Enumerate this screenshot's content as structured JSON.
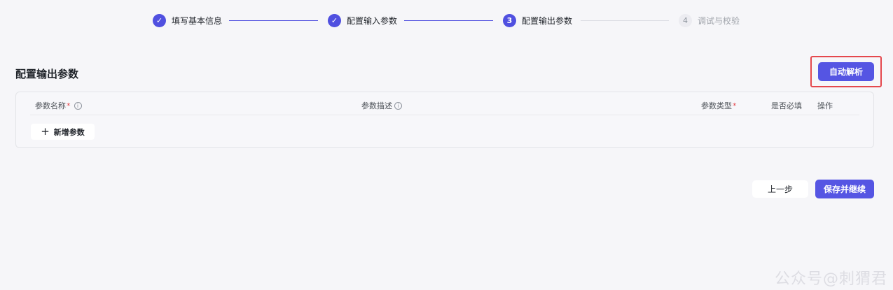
{
  "steps": [
    {
      "label": "填写基本信息",
      "state": "done",
      "marker": "✓"
    },
    {
      "label": "配置输入参数",
      "state": "done",
      "marker": "✓"
    },
    {
      "label": "配置输出参数",
      "state": "active",
      "marker": "3"
    },
    {
      "label": "调试与校验",
      "state": "pending",
      "marker": "4"
    }
  ],
  "section": {
    "title": "配置输出参数"
  },
  "toolbar": {
    "auto_parse_label": "自动解析"
  },
  "table": {
    "columns": {
      "name": "参数名称",
      "description": "参数描述",
      "type": "参数类型",
      "required": "是否必填",
      "actions": "操作"
    },
    "required_mark": "*",
    "info_glyph": "i",
    "add_param_label": "新增参数",
    "add_icon": "+"
  },
  "footer": {
    "prev_label": "上一步",
    "save_label": "保存并继续"
  },
  "watermark": "公众号@刺猬君",
  "colors": {
    "accent": "#5555e3",
    "highlight": "#e5484d",
    "background": "#f6f6f9"
  }
}
